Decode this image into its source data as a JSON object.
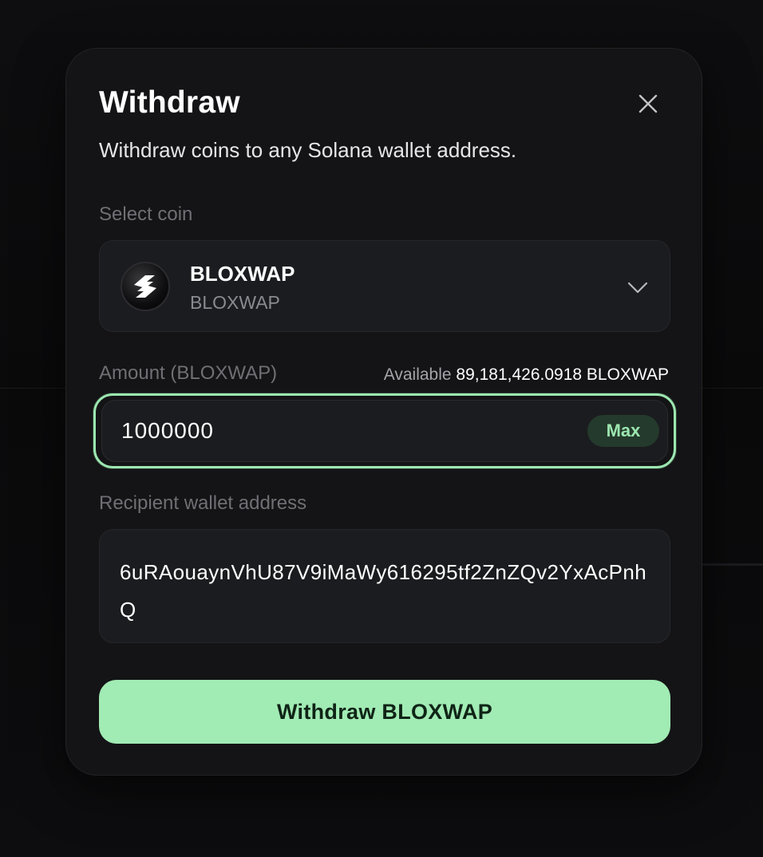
{
  "modal": {
    "title": "Withdraw",
    "subtitle": "Withdraw coins to any Solana wallet address."
  },
  "coin_select": {
    "label": "Select coin",
    "selected_name": "BLOXWAP",
    "selected_symbol": "BLOXWAP"
  },
  "amount": {
    "label": "Amount (BLOXWAP)",
    "available_label": "Available",
    "available_value": "89,181,426.0918 BLOXWAP",
    "value": "1000000",
    "max_label": "Max"
  },
  "recipient": {
    "label": "Recipient wallet address",
    "value": "6uRAouaynVhU87V9iMaWy616295tf2ZnZQv2YxAcPnhQ"
  },
  "submit": {
    "label": "Withdraw BLOXWAP"
  },
  "colors": {
    "accent": "#a1ebb4",
    "focus_ring": "#9ce7b0",
    "surface": "#141416",
    "field": "#1b1c1f"
  },
  "icons": {
    "close": "close-icon",
    "coin_logo": "bloxwap-logo-icon",
    "dropdown": "chevron-down-icon"
  }
}
